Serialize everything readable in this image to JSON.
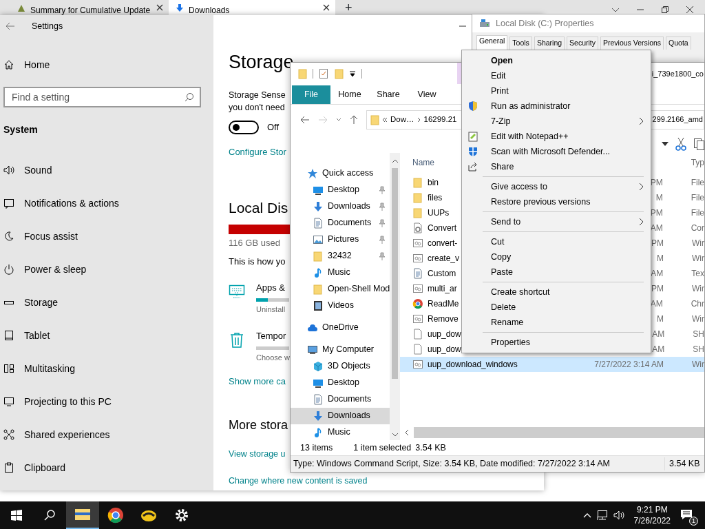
{
  "browser": {
    "tabs": [
      {
        "title": "Summary for Cumulative Update",
        "selected": false
      },
      {
        "title": "Downloads",
        "selected": true
      }
    ],
    "new_tab": "+"
  },
  "settings": {
    "title": "Settings",
    "home": "Home",
    "search": {
      "placeholder": "Find a setting"
    },
    "section": "System",
    "nav_items": [
      {
        "label": "Sound"
      },
      {
        "label": "Notifications & actions"
      },
      {
        "label": "Focus assist"
      },
      {
        "label": "Power & sleep"
      },
      {
        "label": "Storage"
      },
      {
        "label": "Tablet"
      },
      {
        "label": "Multitasking"
      },
      {
        "label": "Projecting to this PC"
      },
      {
        "label": "Shared experiences"
      },
      {
        "label": "Clipboard"
      }
    ],
    "page": {
      "heading": "Storage",
      "sense_lines": [
        "Storage Sense",
        "you don't need"
      ],
      "sense_toggle": {
        "on": false,
        "label": "Off"
      },
      "configure_link": "Configure Stor",
      "disk_heading": "Local Dis",
      "disk_used": "116 GB used",
      "intro": "This is how yo",
      "categories": [
        {
          "title": "Apps &",
          "level": 0.35,
          "subtitle": "Uninstall"
        },
        {
          "title": "Tempor",
          "subtitle": "Choose w"
        }
      ],
      "show_more": "Show more ca",
      "more_heading": "More stora",
      "links": [
        "View storage u",
        "Change where new content is saved"
      ]
    }
  },
  "properties": {
    "title": "Local Disk (C:) Properties",
    "tabs": [
      {
        "label": "General",
        "selected": true
      },
      {
        "label": "Tools",
        "selected": false
      },
      {
        "label": "Sharing",
        "selected": false
      },
      {
        "label": "Security",
        "selected": false
      },
      {
        "label": "Previous Versions",
        "selected": false
      },
      {
        "label": "Quota",
        "selected": false
      }
    ]
  },
  "explorer": {
    "title": "i_739e1800_co",
    "ribbon_tabs": [
      {
        "label": "File",
        "selected": true
      },
      {
        "label": "Home",
        "selected": false
      },
      {
        "label": "Share",
        "selected": false
      },
      {
        "label": "View",
        "selected": false
      }
    ],
    "address": {
      "crumbs": [
        "Dow…",
        "16299.21"
      ],
      "tail": "299.2166_amd"
    },
    "nav": [
      {
        "label": "Quick access",
        "selected": false,
        "children": [
          {
            "label": "Desktop",
            "pinned": true,
            "selected": false
          },
          {
            "label": "Downloads",
            "pinned": true,
            "selected": false
          },
          {
            "label": "Documents",
            "pinned": true,
            "selected": false
          },
          {
            "label": "Pictures",
            "pinned": true,
            "selected": false
          },
          {
            "label": "32432",
            "pinned": true,
            "selected": false
          },
          {
            "label": "Music",
            "pinned": false,
            "selected": false
          },
          {
            "label": "Open-Shell Mod",
            "pinned": false,
            "selected": false
          },
          {
            "label": "Videos",
            "pinned": false,
            "selected": false
          }
        ]
      },
      {
        "label": "OneDrive",
        "selected": false
      },
      {
        "label": "My Computer",
        "selected": false,
        "children": [
          {
            "label": "3D Objects",
            "selected": false
          },
          {
            "label": "Desktop",
            "selected": false
          },
          {
            "label": "Documents",
            "selected": false
          },
          {
            "label": "Downloads",
            "selected": true
          },
          {
            "label": "Music",
            "selected": false
          }
        ]
      }
    ],
    "columns": [
      "Name",
      "Typ"
    ],
    "files": [
      {
        "kind": "folder",
        "name": "bin",
        "date": "PM",
        "type": "File",
        "selected": false
      },
      {
        "kind": "folder",
        "name": "files",
        "date": "M",
        "type": "File",
        "selected": false
      },
      {
        "kind": "folder",
        "name": "UUPs",
        "date": "PM",
        "type": "File",
        "selected": false
      },
      {
        "kind": "config",
        "name": "Convert",
        "date": "AM",
        "type": "Cor",
        "selected": false
      },
      {
        "kind": "script",
        "name": "convert-",
        "date": "PM",
        "type": "Wir",
        "selected": false
      },
      {
        "kind": "script",
        "name": "create_v",
        "date": "M",
        "type": "Wir",
        "selected": false
      },
      {
        "kind": "text",
        "name": "Custom",
        "date": "AM",
        "type": "Tex",
        "selected": false
      },
      {
        "kind": "script",
        "name": "multi_ar",
        "date": "PM",
        "type": "Wir",
        "selected": false
      },
      {
        "kind": "web",
        "name": "ReadMe",
        "date": "AM",
        "type": "Chr",
        "selected": false
      },
      {
        "kind": "script",
        "name": "Remove",
        "date": "M",
        "type": "Wir",
        "selected": false
      },
      {
        "kind": "shell",
        "name": "uup_dow",
        "date": "AM",
        "type": "SH",
        "selected": false
      },
      {
        "kind": "shell",
        "name": "uup_dow",
        "date": "AM",
        "type": "SH",
        "selected": false
      },
      {
        "kind": "script",
        "name": "uup_download_windows",
        "date": "7/27/2022 3:14 AM",
        "type": "Wir",
        "selected": true
      }
    ],
    "status": [
      "13 items",
      "1 item selected",
      "3.54 KB"
    ],
    "details": {
      "text": "Type: Windows Command Script, Size: 3.54 KB, Date modified: 7/27/2022 3:14 AM",
      "size": "3.54 KB"
    }
  },
  "context_menu": [
    {
      "kind": "item",
      "label": "Open",
      "default": true,
      "submenu": false
    },
    {
      "kind": "item",
      "label": "Edit",
      "default": false,
      "submenu": false
    },
    {
      "kind": "item",
      "label": "Print",
      "default": false,
      "submenu": false
    },
    {
      "kind": "item",
      "label": "Run as administrator",
      "default": false,
      "submenu": false
    },
    {
      "kind": "item",
      "label": "7-Zip",
      "default": false,
      "submenu": true
    },
    {
      "kind": "item",
      "label": "Edit with Notepad++",
      "default": false,
      "submenu": false
    },
    {
      "kind": "item",
      "label": "Scan with Microsoft Defender...",
      "default": false,
      "submenu": false
    },
    {
      "kind": "item",
      "label": "Share",
      "default": false,
      "submenu": false
    },
    {
      "kind": "separator"
    },
    {
      "kind": "item",
      "label": "Give access to",
      "default": false,
      "submenu": true
    },
    {
      "kind": "item",
      "label": "Restore previous versions",
      "default": false,
      "submenu": false
    },
    {
      "kind": "separator"
    },
    {
      "kind": "item",
      "label": "Send to",
      "default": false,
      "submenu": true
    },
    {
      "kind": "separator"
    },
    {
      "kind": "item",
      "label": "Cut",
      "default": false,
      "submenu": false
    },
    {
      "kind": "item",
      "label": "Copy",
      "default": false,
      "submenu": false
    },
    {
      "kind": "item",
      "label": "Paste",
      "default": false,
      "submenu": false
    },
    {
      "kind": "separator"
    },
    {
      "kind": "item",
      "label": "Create shortcut",
      "default": false,
      "submenu": false
    },
    {
      "kind": "item",
      "label": "Delete",
      "default": false,
      "submenu": false
    },
    {
      "kind": "item",
      "label": "Rename",
      "default": false,
      "submenu": false
    },
    {
      "kind": "separator"
    },
    {
      "kind": "item",
      "label": "Properties",
      "default": false,
      "submenu": false
    }
  ],
  "taskbar": {
    "apps": [
      {
        "kind": "files",
        "active": true
      },
      {
        "kind": "browser",
        "active": false
      },
      {
        "kind": "app",
        "active": false
      },
      {
        "kind": "gear",
        "active": false
      }
    ],
    "time": "9:21 PM",
    "date": "7/26/2022",
    "notifications": "1"
  }
}
